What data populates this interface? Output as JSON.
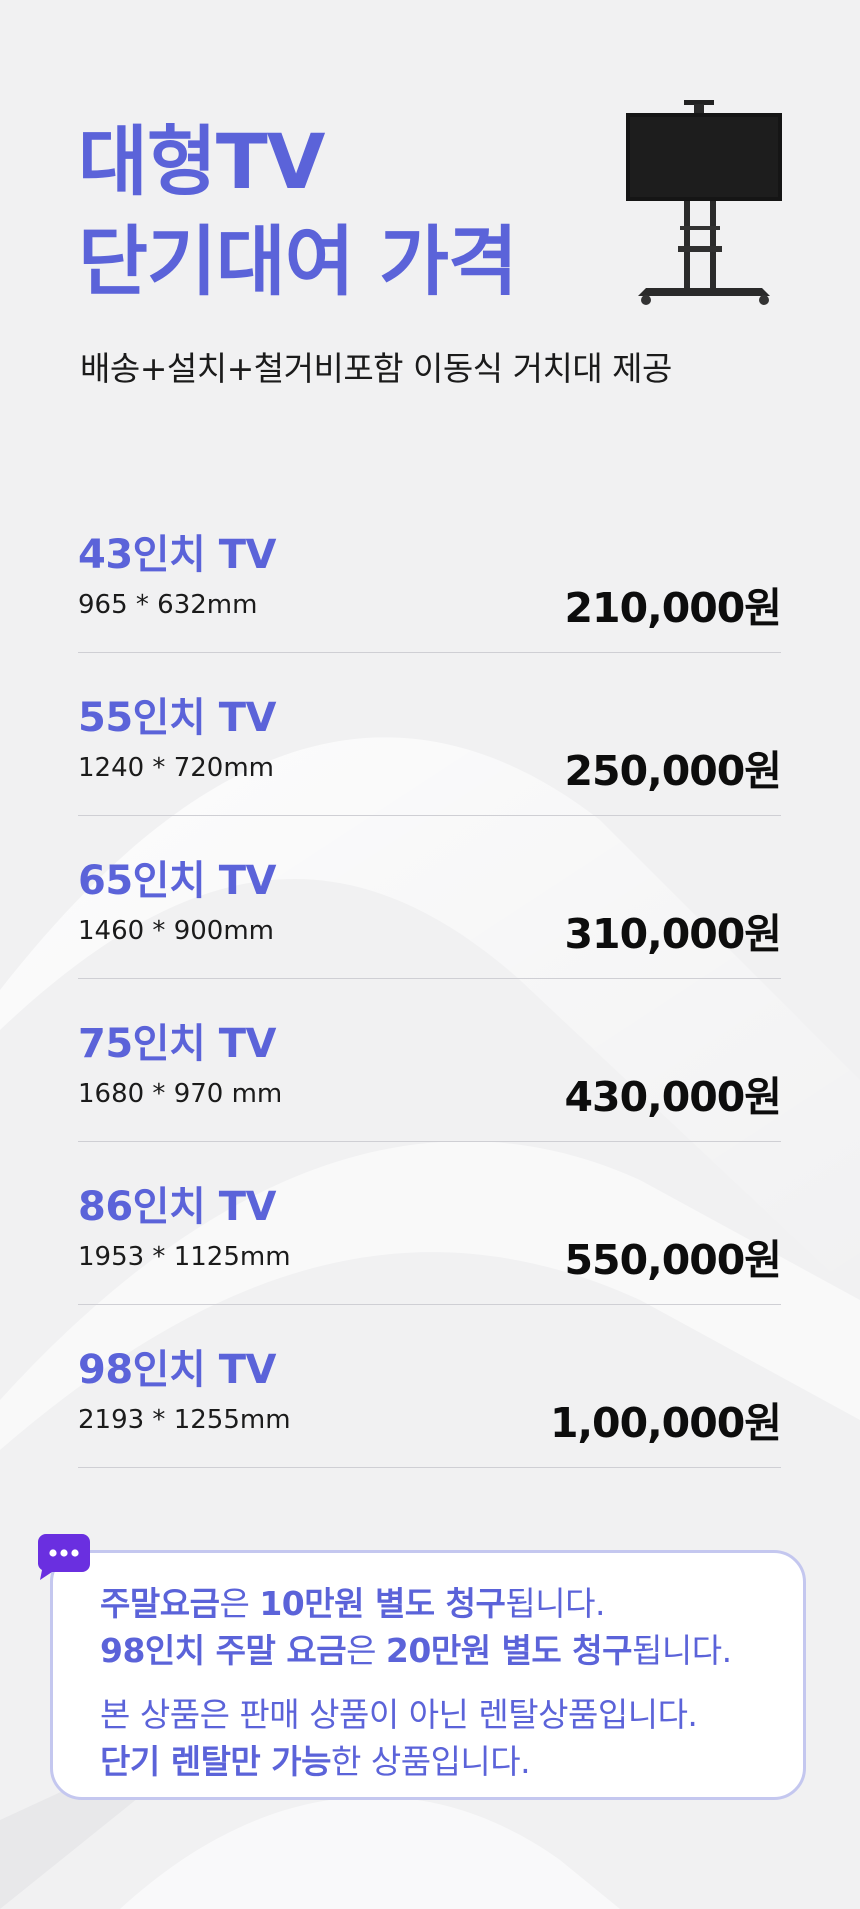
{
  "header": {
    "title_line1": "대형TV",
    "title_line2": "단기대여 가격",
    "subtitle": "배송+설치+철거비포함 이동식 거치대 제공"
  },
  "products": [
    {
      "name": "43인치 TV",
      "size": "965 * 632mm",
      "price": "210,000원"
    },
    {
      "name": "55인치 TV",
      "size": "1240 * 720mm",
      "price": "250,000원"
    },
    {
      "name": "65인치 TV",
      "size": "1460 * 900mm",
      "price": "310,000원"
    },
    {
      "name": "75인치 TV",
      "size": "1680 * 970 mm",
      "price": "430,000원"
    },
    {
      "name": "86인치 TV",
      "size": "1953 * 1125mm",
      "price": "550,000원"
    },
    {
      "name": "98인치 TV",
      "size": "2193 * 1255mm",
      "price": "1,00,000원"
    }
  ],
  "notice": {
    "line1": {
      "bold1": "주말요금",
      "text1": "은 ",
      "bold2": "10만원 별도 청구",
      "text2": "됩니다."
    },
    "line2": {
      "bold1": "98인치 주말 요금",
      "text1": "은 ",
      "bold2": "20만원 별도 청구",
      "text2": "됩니다."
    },
    "line3": "본 상품은 판매 상품이 아닌 렌탈상품입니다.",
    "line4": {
      "bold": "단기 렌탈만 가능",
      "text": "한 상품입니다."
    }
  },
  "colors": {
    "accent": "#5b63d9",
    "price": "#0d0d0d",
    "background": "#f1f1f2",
    "border": "#c4c7ef"
  },
  "icons": {
    "tv": "tv-stand-icon",
    "chat": "chat-bubble-icon"
  }
}
